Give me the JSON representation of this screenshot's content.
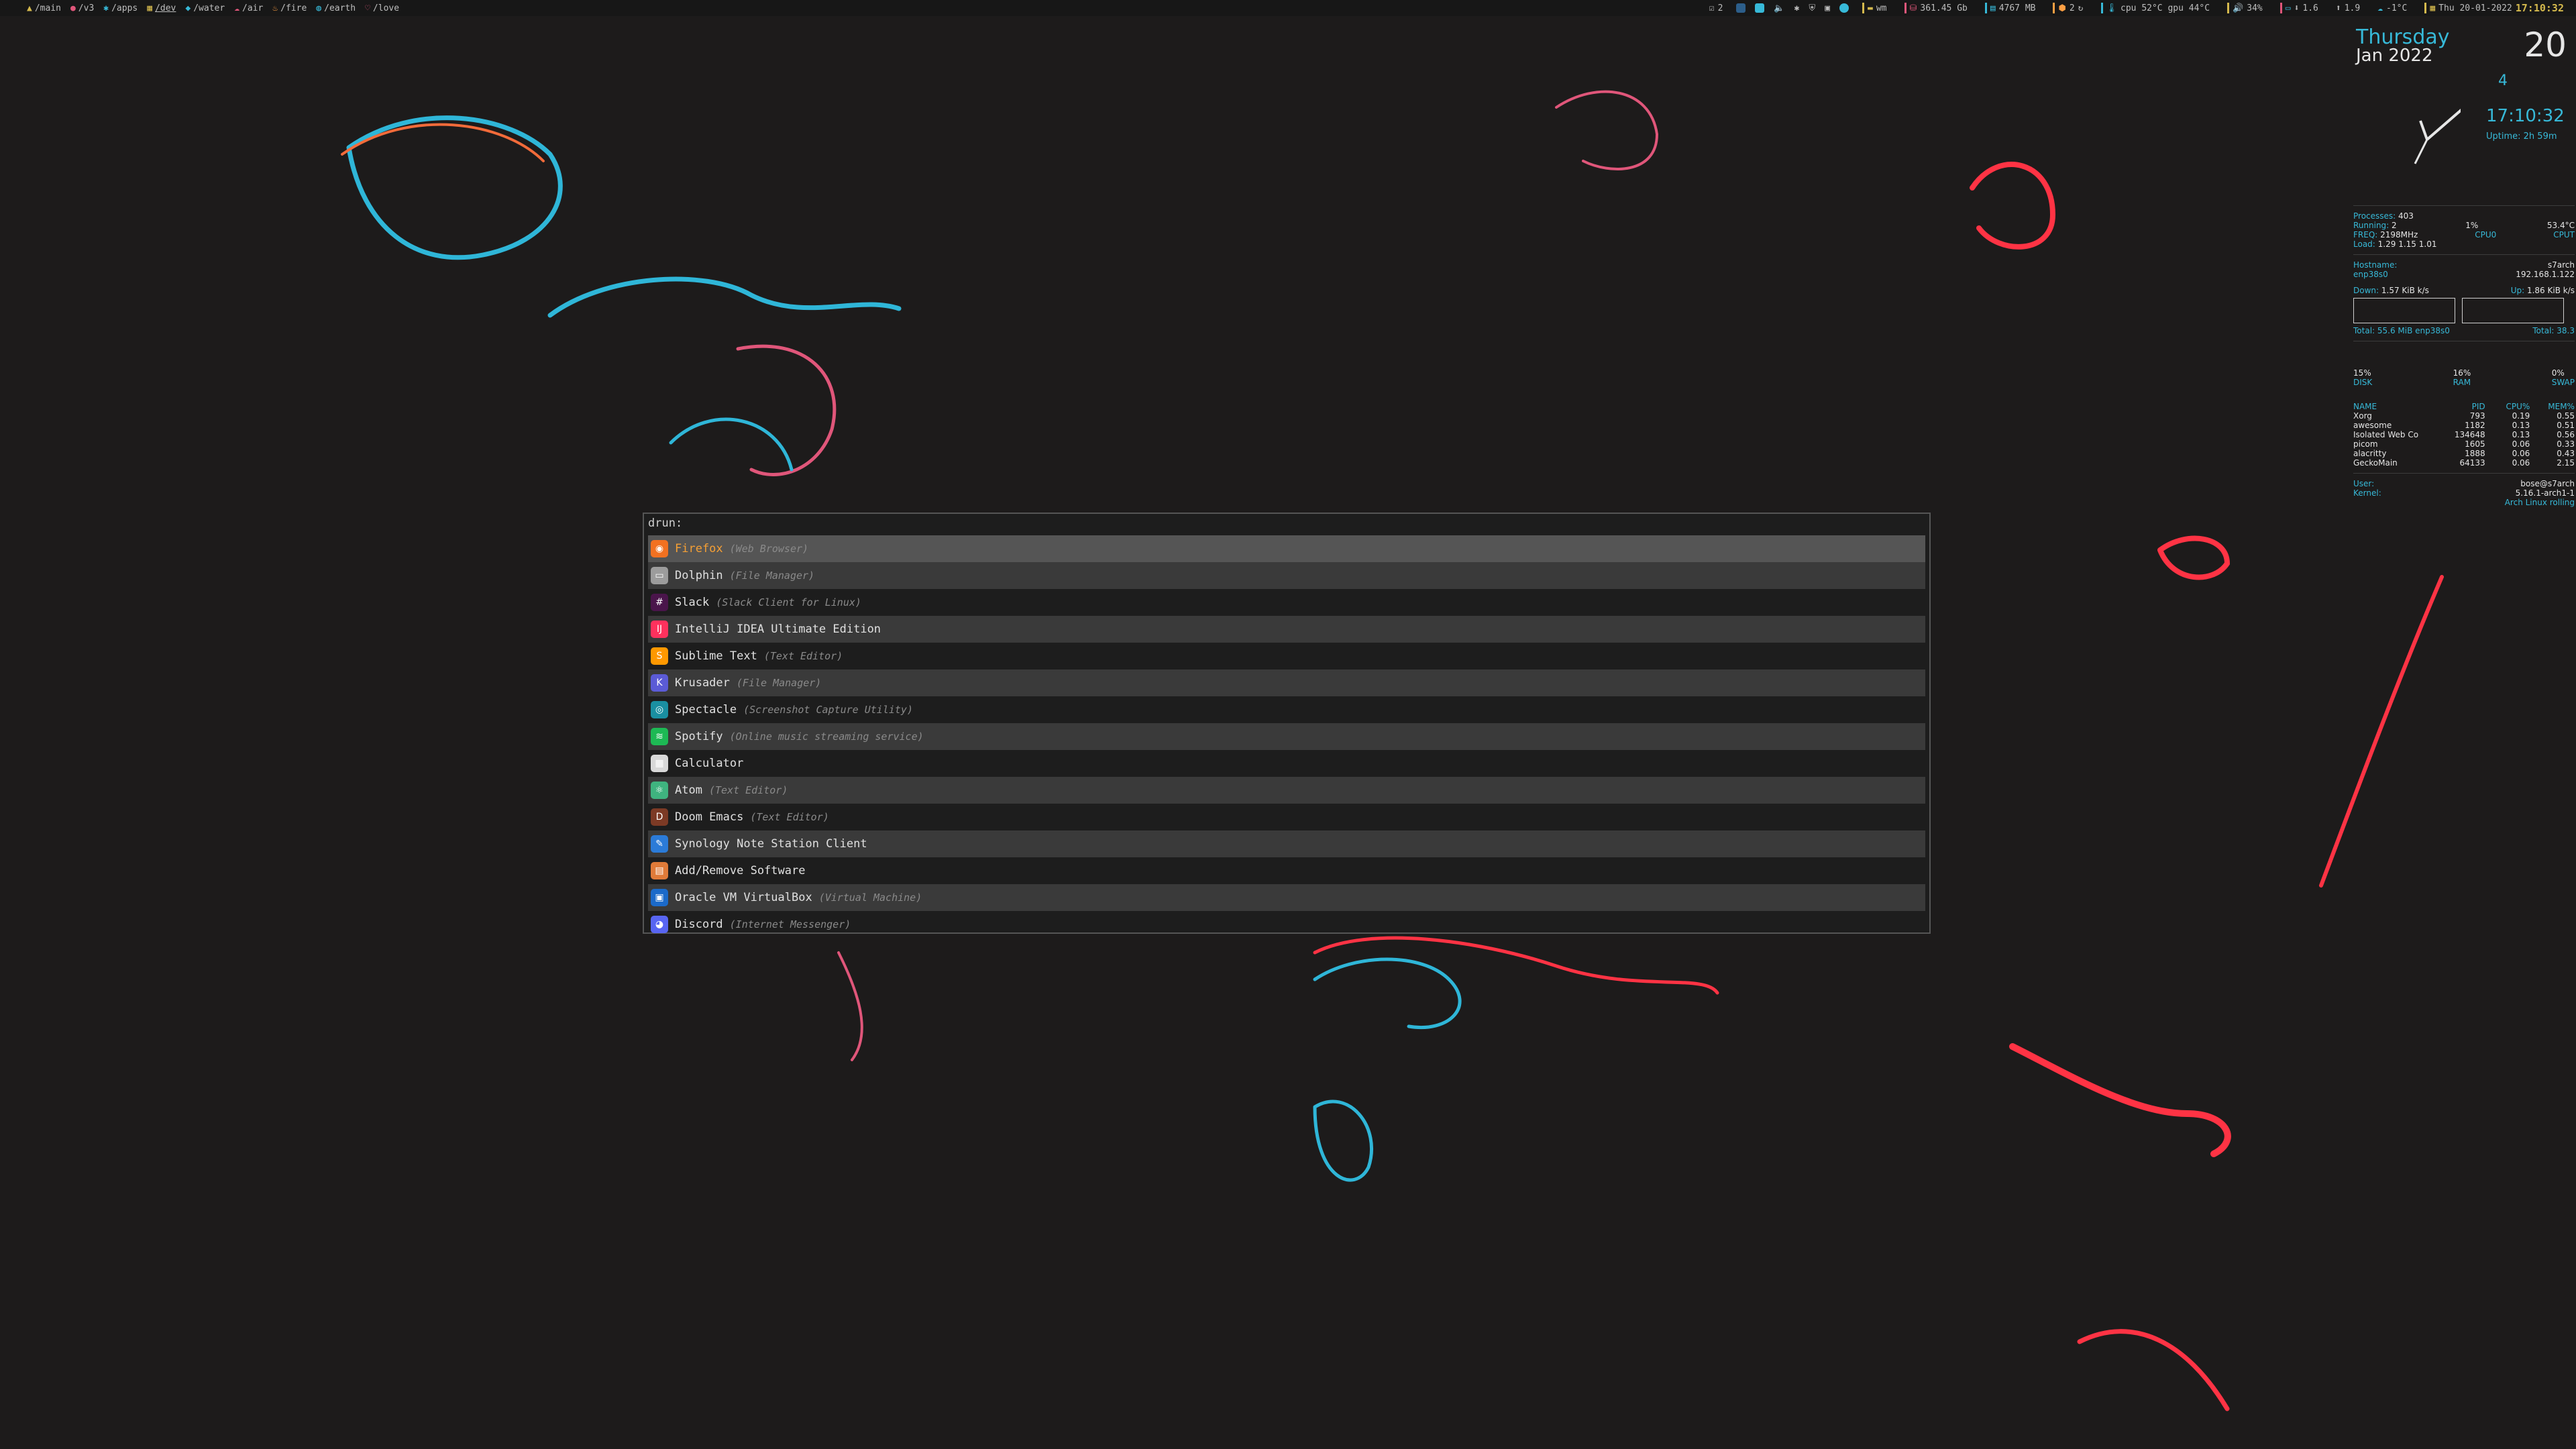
{
  "topbar": {
    "tags": [
      {
        "icon": "arrow-icon",
        "label": "/main"
      },
      {
        "icon": "github-icon",
        "label": "/v3"
      },
      {
        "icon": "apps-icon",
        "label": "/apps"
      },
      {
        "icon": "dev-icon",
        "label": "/dev"
      },
      {
        "icon": "water-icon",
        "label": "/water"
      },
      {
        "icon": "cloud-icon",
        "label": "/air"
      },
      {
        "icon": "fire-icon",
        "label": "/fire"
      },
      {
        "icon": "globe-icon",
        "label": "/earth"
      },
      {
        "icon": "heart-icon",
        "label": "/love"
      }
    ],
    "layout_count": "2",
    "net_label": "wm",
    "disk": "361.45 Gb",
    "mem": "4767 MB",
    "updates": "2",
    "temps": "cpu 52°C gpu 44°C",
    "volume": "34%",
    "net_down": "1.6",
    "net_up": "1.9",
    "weather": "-1°C",
    "date": "Thu 20-01-2022",
    "time": "17:10:32",
    "colors": {
      "accent": "#37b9d8",
      "rose": "#e0567a",
      "yellow": "#d4b94d",
      "orange": "#ff9f43"
    }
  },
  "rofi": {
    "prompt": "drun:",
    "entries": [
      {
        "name": "Firefox",
        "desc": "(Web Browser)",
        "icon": "firefox-icon",
        "color": "#f27121"
      },
      {
        "name": "Dolphin",
        "desc": "(File Manager)",
        "icon": "dolphin-icon",
        "color": "#9c9c9c"
      },
      {
        "name": "Slack",
        "desc": "(Slack Client for Linux)",
        "icon": "slack-icon",
        "color": "#4a154b"
      },
      {
        "name": "IntelliJ IDEA Ultimate Edition",
        "desc": "",
        "icon": "intellij-icon",
        "color": "#fe315d"
      },
      {
        "name": "Sublime Text",
        "desc": "(Text Editor)",
        "icon": "sublime-icon",
        "color": "#ff9800"
      },
      {
        "name": "Krusader",
        "desc": "(File Manager)",
        "icon": "krusader-icon",
        "color": "#5b5bd6"
      },
      {
        "name": "Spectacle",
        "desc": "(Screenshot Capture Utility)",
        "icon": "spectacle-icon",
        "color": "#1a8fa1"
      },
      {
        "name": "Spotify",
        "desc": "(Online music streaming service)",
        "icon": "spotify-icon",
        "color": "#1db954"
      },
      {
        "name": "Calculator",
        "desc": "",
        "icon": "calculator-icon",
        "color": "#d8d8d8"
      },
      {
        "name": "Atom",
        "desc": "(Text Editor)",
        "icon": "atom-icon",
        "color": "#3fb37f"
      },
      {
        "name": "Doom Emacs",
        "desc": "(Text Editor)",
        "icon": "doom-emacs-icon",
        "color": "#7c3a25"
      },
      {
        "name": "Synology Note Station Client",
        "desc": "",
        "icon": "synology-icon",
        "color": "#2b7bd8"
      },
      {
        "name": "Add/Remove Software",
        "desc": "",
        "icon": "software-icon",
        "color": "#e07b39"
      },
      {
        "name": "Oracle VM VirtualBox",
        "desc": "(Virtual Machine)",
        "icon": "virtualbox-icon",
        "color": "#1b6ac9"
      },
      {
        "name": "Discord",
        "desc": "(Internet Messenger)",
        "icon": "discord-icon",
        "color": "#5865f2"
      }
    ]
  },
  "conky": {
    "day": "Thursday",
    "month_year": "Jan 2022",
    "date_num": "20",
    "week": "4",
    "time": "17:10:32",
    "uptime": "Uptime: 2h 59m",
    "processes_label": "Processes:",
    "processes": "403",
    "running_label": "Running:",
    "running": "2",
    "cpu0_pct": "1%",
    "cpu0_label": "CPU0",
    "cpu_temp": "53.4°C",
    "cpu_temp_label": "CPUT",
    "freq_label": "FREQ:",
    "freq": "2198MHz",
    "load_label": "Load:",
    "load": "1.29 1.15 1.01",
    "hostname_label": "Hostname:",
    "hostname": "s7arch",
    "iface": "enp38s0",
    "ip": "192.168.1.122",
    "down_label": "Down:",
    "down": "1.57 KiB k/s",
    "up_label": "Up:",
    "up": "1.86 KiB k/s",
    "total_down": "Total: 55.6 MiB enp38s0",
    "total_up": "Total: 38.3",
    "disk_pct": "15%",
    "disk_label": "DISK",
    "ram_pct": "16%",
    "ram_label": "RAM",
    "swap_pct": "0%",
    "swap_label": "SWAP",
    "proc_headers": [
      "NAME",
      "PID",
      "CPU%",
      "MEM%"
    ],
    "procs": [
      [
        "Xorg",
        "793",
        "0.19",
        "0.55"
      ],
      [
        "awesome",
        "1182",
        "0.13",
        "0.51"
      ],
      [
        "Isolated Web Co",
        "134648",
        "0.13",
        "0.56"
      ],
      [
        "picom",
        "1605",
        "0.06",
        "0.33"
      ],
      [
        "alacritty",
        "1888",
        "0.06",
        "0.43"
      ],
      [
        "GeckoMain",
        "64133",
        "0.06",
        "2.15"
      ]
    ],
    "user_label": "User:",
    "user": "bose@s7arch",
    "kernel_label": "Kernel:",
    "kernel": "5.16.1-arch1-1",
    "distro": "Arch Linux rolling"
  }
}
